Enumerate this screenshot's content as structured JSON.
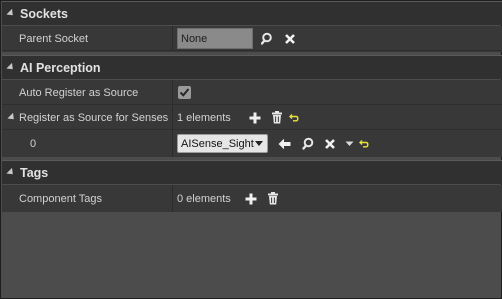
{
  "sections": {
    "sockets": {
      "title": "Sockets",
      "parent_socket": {
        "label": "Parent Socket",
        "value": "None"
      }
    },
    "ai_perception": {
      "title": "AI Perception",
      "auto_register": {
        "label": "Auto Register as Source",
        "checked": true
      },
      "register_senses": {
        "label": "Register as Source for Senses",
        "count": "1 elements"
      },
      "element0": {
        "index": "0",
        "value": "AISense_Sight"
      }
    },
    "tags": {
      "title": "Tags",
      "component_tags": {
        "label": "Component Tags",
        "count": "0 elements"
      }
    }
  },
  "icons": {
    "search": "search-icon",
    "clear": "close-icon",
    "add": "plus-icon",
    "delete": "trash-icon",
    "reset": "reset-to-default-icon",
    "use_selected": "arrow-left-icon",
    "dropdown": "chevron-down-icon",
    "check": "checkmark-icon"
  },
  "colors": {
    "reset_icon": "#e8e03a",
    "background": "#4c4c4c",
    "header": "#303030",
    "row": "#383838"
  }
}
